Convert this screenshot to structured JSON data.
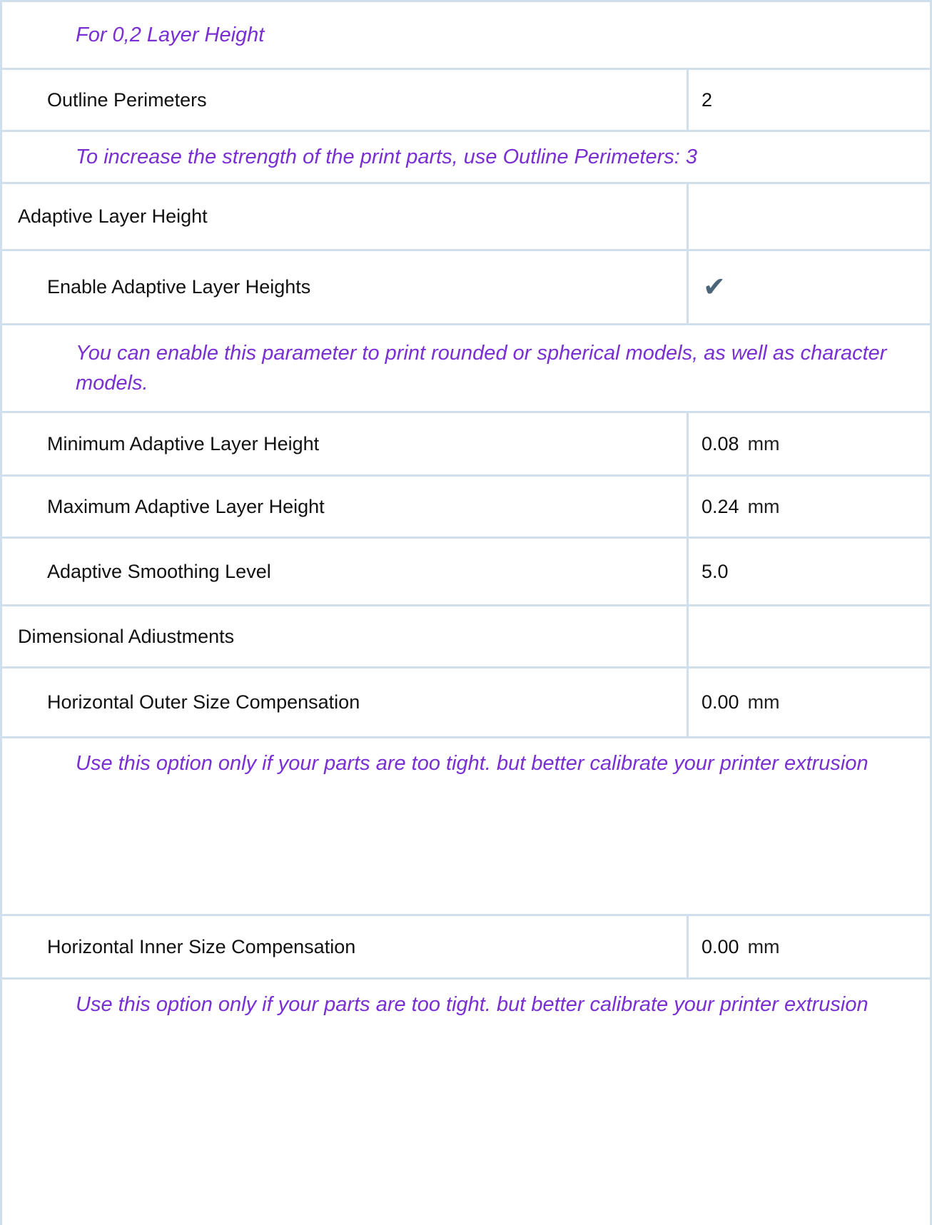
{
  "rows": {
    "note_layer_height": "For 0,2 Layer Height",
    "outline_perimeters": {
      "label": "Outline Perimeters",
      "value": "2"
    },
    "note_perimeters": "To increase the strength of the print parts, use Outline Perimeters: 3",
    "section_adaptive": "Adaptive Layer Height",
    "enable_adaptive": {
      "label": "Enable Adaptive Layer Heights",
      "checked": true,
      "glyph": "✔"
    },
    "note_adaptive": "You can enable this parameter to print rounded or spherical models, as well as character models.",
    "min_adaptive": {
      "label": "Minimum Adaptive Layer Height",
      "value": "0.08",
      "unit": "mm"
    },
    "max_adaptive": {
      "label": "Maximum Adaptive Layer Height",
      "value": "0.24",
      "unit": "mm"
    },
    "smoothing": {
      "label": "Adaptive Smoothing Level",
      "value": "5.0"
    },
    "section_dimensional": "Dimensional Adiustments",
    "outer_comp": {
      "label": "Horizontal Outer Size Compensation",
      "value": "0.00",
      "unit": "mm"
    },
    "note_outer": "Use this option only if your parts are too tight. but better calibrate your printer extrusion",
    "inner_comp": {
      "label": "Horizontal Inner Size Compensation",
      "value": "0.00",
      "unit": "mm"
    },
    "note_inner": "Use this option only if your parts are too tight. but better calibrate your printer extrusion"
  },
  "colors": {
    "border": "#cfdfec",
    "note_text": "#7a2fd3",
    "check": "#4d6579"
  }
}
